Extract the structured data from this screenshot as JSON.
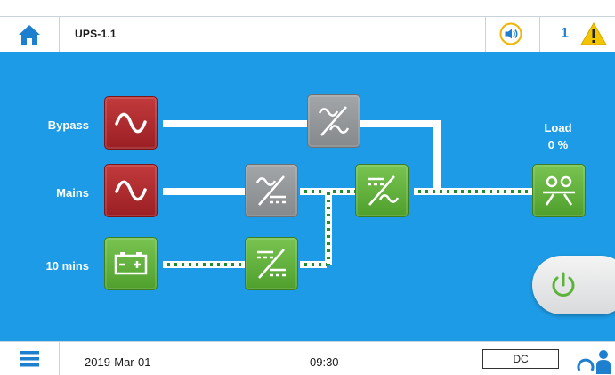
{
  "header": {
    "device": "UPS-1.1",
    "alarm_count": "1",
    "icons": {
      "home": "home-icon",
      "sound": "speaker-icon",
      "warning": "warning-icon"
    }
  },
  "mimic": {
    "labels": {
      "bypass": "Bypass",
      "mains": "Mains",
      "battery": "10 mins"
    },
    "load": {
      "title": "Load",
      "value": "0 %"
    }
  },
  "footer": {
    "date": "2019-Mar-01",
    "time": "09:30",
    "mode": "DC"
  },
  "colors": {
    "background": "#1e9be6",
    "fault_red": "#b22a2e",
    "inactive_gray": "#9a9da0",
    "active_green": "#62b23c",
    "accent_blue": "#1e7fcf",
    "warning_yellow": "#f3c400"
  }
}
